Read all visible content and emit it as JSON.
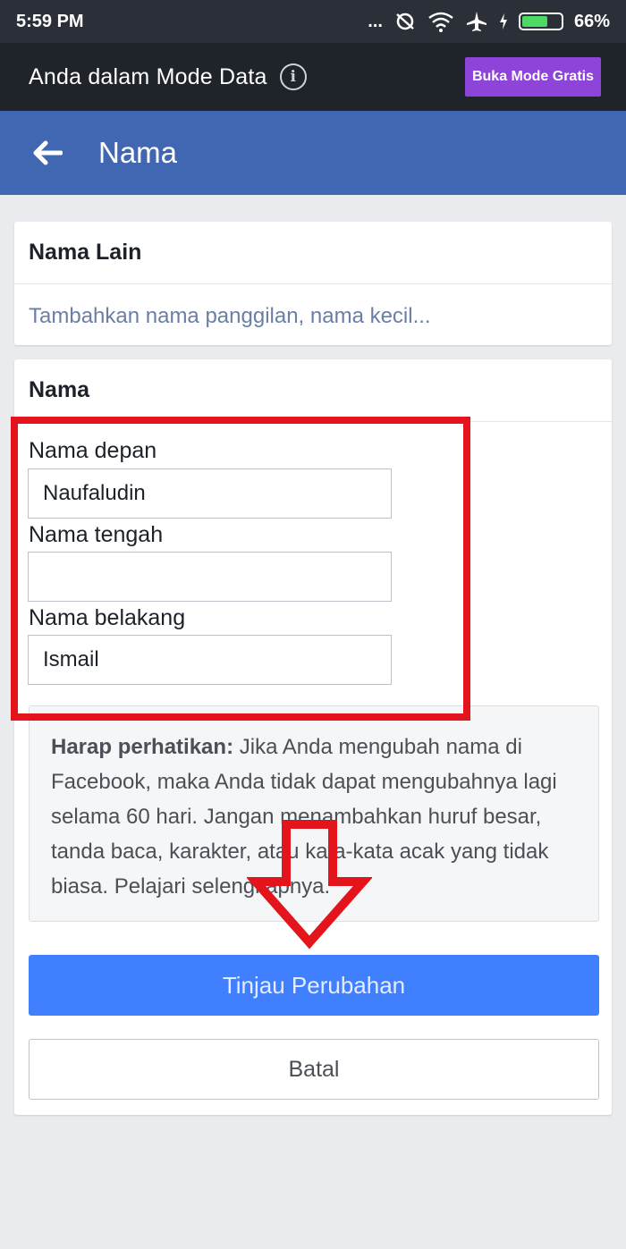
{
  "status_bar": {
    "time": "5:59 PM",
    "dots": "...",
    "battery_percent": "66%",
    "battery_level": 0.66
  },
  "data_mode": {
    "text": "Anda dalam Mode Data",
    "info_glyph": "i",
    "free_button": "Buka Mode Gratis",
    "accent": "#8e44d8"
  },
  "header": {
    "title": "Nama",
    "color": "#4267b2"
  },
  "other_names": {
    "heading": "Nama Lain",
    "link": "Tambahkan nama panggilan, nama kecil..."
  },
  "name_form": {
    "heading": "Nama",
    "first_label": "Nama depan",
    "first_value": "Naufaludin",
    "middle_label": "Nama tengah",
    "middle_value": "",
    "last_label": "Nama belakang",
    "last_value": "Ismail"
  },
  "notice": {
    "bold": "Harap perhatikan:",
    "text": " Jika Anda mengubah nama di Facebook, maka Anda tidak dapat mengubahnya lagi selama 60 hari. Jangan menambahkan huruf besar, tanda baca, karakter, atau kata-kata acak yang tidak biasa. Pelajari selengkapnya."
  },
  "buttons": {
    "review": "Tinjau Perubahan",
    "cancel": "Batal",
    "primary_color": "#4080ff"
  },
  "annotation": {
    "color": "#e3141b"
  }
}
